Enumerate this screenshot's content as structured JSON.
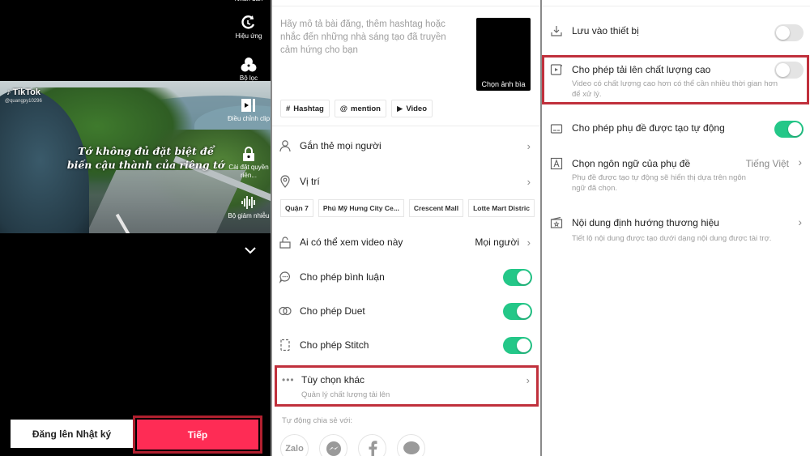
{
  "editor": {
    "tools": [
      {
        "icon": "text-icon",
        "label": "Nhãn dán"
      },
      {
        "icon": "effects-icon",
        "label": "Hiệu ứng"
      },
      {
        "icon": "filters-icon",
        "label": "Bộ lọc"
      },
      {
        "icon": "adjust-clips-icon",
        "label": "Điều chỉnh clip"
      },
      {
        "icon": "lock-icon",
        "label": "Cài đặt quyền riên..."
      },
      {
        "icon": "noise-reducer-icon",
        "label": "Bộ giảm nhiễu"
      }
    ],
    "video": {
      "brand": "TikTok",
      "username": "@quangpy10296",
      "caption_line1": "Tớ không đủ đặt biệt để",
      "caption_line2": "biến cậu thành của riêng tớ"
    },
    "buttons": {
      "diary": "Đăng lên Nhật ký",
      "next": "Tiếp"
    }
  },
  "post": {
    "description_placeholder": "Hãy mô tả bài đăng, thêm hashtag hoặc nhắc đến những nhà sáng tạo đã truyền cảm hứng cho bạn",
    "cover_label": "Chọn ảnh bìa",
    "chips": [
      "Hashtag",
      "mention",
      "Video"
    ],
    "tag_people": "Gắn thẻ mọi người",
    "location": "Vị trí",
    "location_suggestions": [
      "Quận 7",
      "Phú Mỹ Hưng City Ce...",
      "Crescent Mall",
      "Lotte Mart Distric"
    ],
    "who_can_view": {
      "label": "Ai có thể xem video này",
      "value": "Mọi người"
    },
    "toggles": [
      {
        "label": "Cho phép bình luận",
        "on": true
      },
      {
        "label": "Cho phép Duet",
        "on": true
      },
      {
        "label": "Cho phép Stitch",
        "on": true
      }
    ],
    "more_options": {
      "label": "Tùy chọn khác",
      "sub": "Quản lý chất lượng tải lên"
    },
    "share_label": "Tự động chia sẻ với:",
    "share_targets": [
      "Zalo",
      "Messenger",
      "Facebook",
      "Messages"
    ]
  },
  "more": {
    "save_device": {
      "label": "Lưu vào thiết bị",
      "on": false
    },
    "hq_upload": {
      "label": "Cho phép tải lên chất lượng cao",
      "sub": "Video có chất lượng cao hơn có thể cần nhiều thời gian hơn để xử lý.",
      "on": false
    },
    "auto_captions": {
      "label": "Cho phép phụ đề được tạo tự động",
      "on": true
    },
    "caption_language": {
      "label": "Chọn ngôn ngữ của phụ đề",
      "value": "Tiếng Việt",
      "sub": "Phụ đề được tạo tự động sẽ hiển thị dựa trên ngôn ngữ đã chọn."
    },
    "branded_content": {
      "label": "Nội dung định hướng thương hiệu",
      "sub": "Tiết lộ nội dung được tạo dưới dạng nội dung được tài trợ."
    }
  },
  "colors": {
    "accent": "#fe2c55",
    "highlight_border": "#c0303c",
    "toggle_on": "#24c788",
    "toggle_off": "#e4e4e4"
  }
}
